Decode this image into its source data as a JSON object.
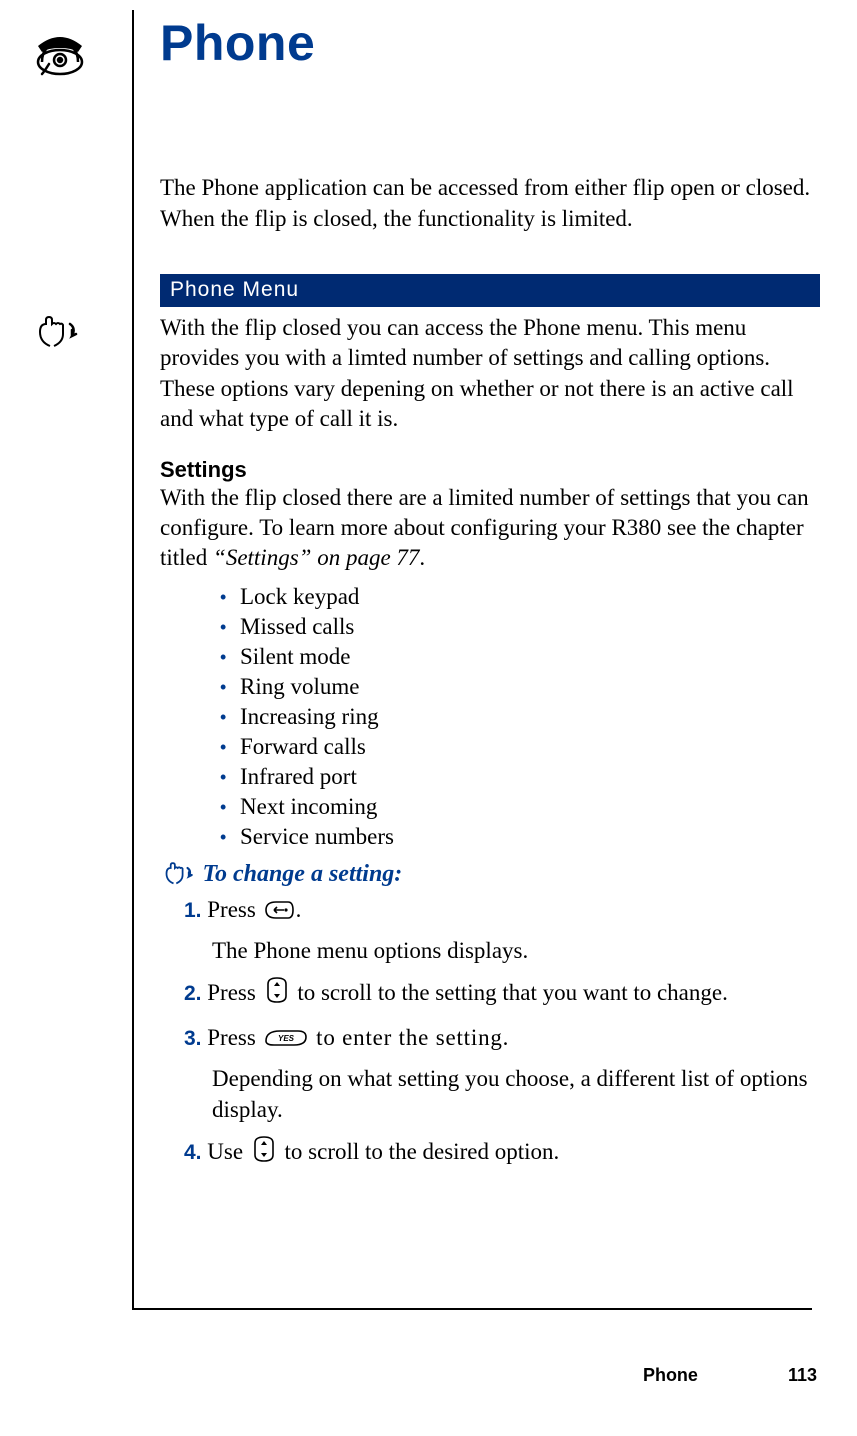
{
  "title": "Phone",
  "intro": "The Phone application can be accessed from either flip open or closed. When the flip is closed, the functionality is limited.",
  "section_bar": "Phone Menu",
  "section_text": "With the flip closed you can access the Phone menu. This menu provides you with a limted number of settings and calling options. These options vary depening on whether or not there is an active call and what type of call it is.",
  "settings": {
    "heading": "Settings",
    "intro_a": "With the flip closed there are a limited number of settings that you can configure. To learn more about configuring your R380 see the chapter titled ",
    "intro_ref": "“Settings” on page 77",
    "intro_b": ".",
    "items": [
      "Lock keypad",
      "Missed calls",
      "Silent mode",
      "Ring volume",
      "Increasing ring",
      "Forward calls",
      "Infrared port",
      "Next incoming",
      "Service numbers"
    ]
  },
  "procedure": {
    "title": "To change a setting:",
    "steps": [
      {
        "num": "1.",
        "a": "Press ",
        "b": ".",
        "sub": "The Phone menu options displays."
      },
      {
        "num": "2.",
        "a": "Press ",
        "b": " to scroll to the setting that you want to change."
      },
      {
        "num": "3.",
        "a": "Press ",
        "b": " to enter the setting.",
        "sub": "Depending on what setting you choose, a different list of options display."
      },
      {
        "num": "4.",
        "a": "Use ",
        "b": " to scroll to the desired option."
      }
    ]
  },
  "footer": {
    "section": "Phone",
    "page": "113"
  }
}
